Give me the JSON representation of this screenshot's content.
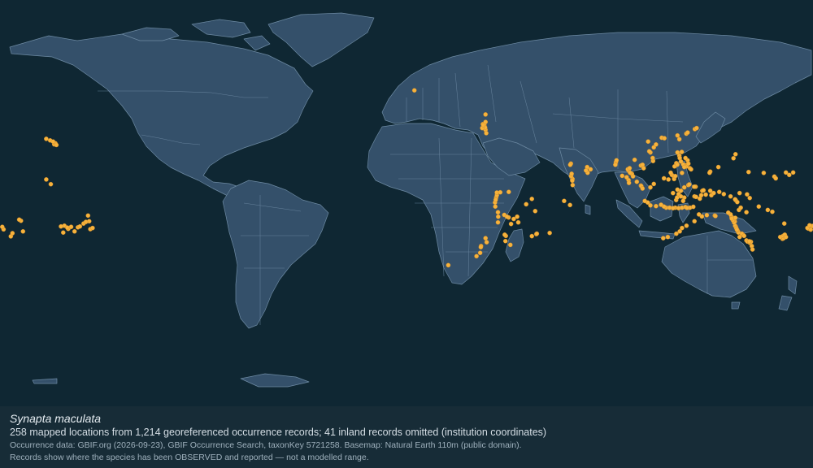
{
  "caption": {
    "species": "Synapta maculata",
    "summary": "258 mapped locations from 1,214 georeferenced occurrence records; 41 inland records omitted (institution coordinates)",
    "source": "Occurrence data: GBIF.org (2026-09-23), GBIF Occurrence Search, taxonKey 5721258. Basemap: Natural Earth 110m (public domain).",
    "note": "Records show where the species has been OBSERVED and reported — not a modelled range."
  },
  "colors": {
    "ocean": "#0f2733",
    "land": "#34506a",
    "border": "#6d8aa3",
    "occurrence": "#f7b23b",
    "caption_bg": "#172c37"
  },
  "occurrences": [
    [
      -156.0,
      19.6
    ],
    [
      -157.8,
      21.3
    ],
    [
      -155.5,
      20.0
    ],
    [
      -159.5,
      22.0
    ],
    [
      -156.5,
      20.8
    ],
    [
      -155.0,
      19.3
    ],
    [
      -149.6,
      -17.6
    ],
    [
      -149.8,
      -17.9
    ],
    [
      -151.5,
      -16.5
    ],
    [
      -150.2,
      -17.3
    ],
    [
      -148.5,
      -17.0
    ],
    [
      -145.5,
      -17.2
    ],
    [
      -144.6,
      -16.8
    ],
    [
      -140.0,
      -18.0
    ],
    [
      -140.5,
      -14.5
    ],
    [
      -141.0,
      -12.0
    ],
    [
      -139.0,
      -17.5
    ],
    [
      -153.0,
      -16.8
    ],
    [
      -143.0,
      -15.5
    ],
    [
      -142.0,
      -14.8
    ],
    [
      -152.0,
      -19.5
    ],
    [
      -147.0,
      -19.0
    ],
    [
      -157.5,
      1.9
    ],
    [
      -159.5,
      4.0
    ],
    [
      -170.7,
      -14.3
    ],
    [
      -171.5,
      -13.8
    ],
    [
      -175.2,
      -21.2
    ],
    [
      -174.5,
      -19.8
    ],
    [
      -169.8,
      -19.0
    ],
    [
      -178.4,
      -18.1
    ],
    [
      -179.0,
      -17.0
    ],
    [
      178.0,
      -17.8
    ],
    [
      179.0,
      -18.2
    ],
    [
      177.5,
      -17.5
    ],
    [
      179.8,
      -16.6
    ],
    [
      178.5,
      -16.3
    ],
    [
      166.5,
      -22.3
    ],
    [
      167.0,
      -22.0
    ],
    [
      165.5,
      -21.5
    ],
    [
      166.8,
      -21.0
    ],
    [
      167.5,
      -20.5
    ],
    [
      168.0,
      -21.5
    ],
    [
      167.3,
      -15.5
    ],
    [
      160.0,
      -9.5
    ],
    [
      162.0,
      -10.3
    ],
    [
      156.0,
      -8.0
    ],
    [
      151.5,
      7.3
    ],
    [
      158.2,
      6.9
    ],
    [
      162.9,
      5.3
    ],
    [
      163.5,
      4.5
    ],
    [
      168.0,
      7.1
    ],
    [
      171.2,
      7.1
    ],
    [
      169.5,
      6.0
    ],
    [
      134.5,
      7.5
    ],
    [
      134.2,
      7.0
    ],
    [
      144.8,
      13.4
    ],
    [
      145.7,
      15.2
    ],
    [
      138.1,
      9.5
    ],
    [
      123.9,
      24.3
    ],
    [
      127.7,
      26.3
    ],
    [
      128.5,
      26.8
    ],
    [
      124.5,
      24.8
    ],
    [
      120.8,
      21.8
    ],
    [
      120.0,
      23.5
    ],
    [
      146.8,
      -19.0
    ],
    [
      147.0,
      -19.5
    ],
    [
      145.8,
      -16.9
    ],
    [
      145.5,
      -16.5
    ],
    [
      146.0,
      -17.5
    ],
    [
      145.4,
      -14.7
    ],
    [
      145.0,
      -15.0
    ],
    [
      144.5,
      -14.0
    ],
    [
      143.9,
      -12.5
    ],
    [
      143.5,
      -11.5
    ],
    [
      142.5,
      -10.7
    ],
    [
      150.5,
      -23.0
    ],
    [
      151.0,
      -23.5
    ],
    [
      152.0,
      -24.0
    ],
    [
      149.0,
      -20.5
    ],
    [
      148.5,
      -20.0
    ],
    [
      152.9,
      -25.5
    ],
    [
      153.2,
      -27.0
    ],
    [
      147.5,
      -21.5
    ],
    [
      146.5,
      -18.5
    ],
    [
      152.5,
      -23.6
    ],
    [
      145.6,
      -13.0
    ],
    [
      144.0,
      -13.3
    ],
    [
      149.5,
      -21.0
    ],
    [
      151.8,
      -23.4
    ],
    [
      146.3,
      -18.2
    ],
    [
      130.8,
      -12.4
    ],
    [
      129.5,
      -11.5
    ],
    [
      133.0,
      -11.8
    ],
    [
      136.5,
      -12.0
    ],
    [
      124.0,
      -16.5
    ],
    [
      122.0,
      -17.5
    ],
    [
      121.0,
      -19.0
    ],
    [
      115.7,
      -21.5
    ],
    [
      119.5,
      -20.0
    ],
    [
      113.7,
      -22.0
    ],
    [
      127.5,
      -14.5
    ],
    [
      136.8,
      -12.2
    ],
    [
      115.0,
      -8.5
    ],
    [
      114.0,
      -8.0
    ],
    [
      116.5,
      -8.5
    ],
    [
      119.0,
      -8.5
    ],
    [
      120.5,
      -8.7
    ],
    [
      122.0,
      -8.5
    ],
    [
      123.5,
      -8.2
    ],
    [
      125.5,
      -8.5
    ],
    [
      127.0,
      -8.1
    ],
    [
      118.0,
      -8.7
    ],
    [
      110.5,
      -7.8
    ],
    [
      106.8,
      -6.2
    ],
    [
      108.0,
      -7.5
    ],
    [
      112.7,
      -7.2
    ],
    [
      105.5,
      -5.5
    ],
    [
      124.2,
      -8.6
    ],
    [
      119.4,
      -5.1
    ],
    [
      119.8,
      -4.0
    ],
    [
      120.5,
      -2.5
    ],
    [
      123.0,
      -4.0
    ],
    [
      122.5,
      -5.5
    ],
    [
      121.5,
      -1.0
    ],
    [
      124.8,
      1.5
    ],
    [
      125.2,
      1.8
    ],
    [
      123.0,
      0.5
    ],
    [
      120.0,
      -0.5
    ],
    [
      121.5,
      -3.5
    ],
    [
      118.0,
      -2.0
    ],
    [
      127.5,
      -3.5
    ],
    [
      128.2,
      -3.7
    ],
    [
      129.9,
      -4.5
    ],
    [
      130.5,
      -3.0
    ],
    [
      131.0,
      -1.0
    ],
    [
      131.5,
      -0.8
    ],
    [
      134.5,
      -1.0
    ],
    [
      135.0,
      -3.0
    ],
    [
      136.0,
      -2.0
    ],
    [
      138.5,
      -1.5
    ],
    [
      140.5,
      -2.5
    ],
    [
      128.0,
      0.8
    ],
    [
      127.4,
      0.8
    ],
    [
      132.5,
      -2.7
    ],
    [
      143.5,
      -3.5
    ],
    [
      145.8,
      -5.2
    ],
    [
      146.5,
      -6.0
    ],
    [
      147.2,
      -9.5
    ],
    [
      150.5,
      -10.5
    ],
    [
      152.0,
      -4.2
    ],
    [
      150.8,
      -2.6
    ],
    [
      145.5,
      -4.8
    ],
    [
      147.5,
      -2.0
    ],
    [
      148.0,
      -8.5
    ],
    [
      120.8,
      14.5
    ],
    [
      121.0,
      13.5
    ],
    [
      123.8,
      10.3
    ],
    [
      124.0,
      9.8
    ],
    [
      122.5,
      10.7
    ],
    [
      118.7,
      9.8
    ],
    [
      119.5,
      11.2
    ],
    [
      124.5,
      12.5
    ],
    [
      125.5,
      9.0
    ],
    [
      122.0,
      6.9
    ],
    [
      121.5,
      12.0
    ],
    [
      120.0,
      16.0
    ],
    [
      123.5,
      13.5
    ],
    [
      119.9,
      10.6
    ],
    [
      126.0,
      8.5
    ],
    [
      121.9,
      16.2
    ],
    [
      123.0,
      9.5
    ],
    [
      124.8,
      11.0
    ],
    [
      117.5,
      6.0
    ],
    [
      118.5,
      5.0
    ],
    [
      116.0,
      4.0
    ],
    [
      114.0,
      4.5
    ],
    [
      118.5,
      4.2
    ],
    [
      119.0,
      5.5
    ],
    [
      117.0,
      7.0
    ],
    [
      109.5,
      2.0
    ],
    [
      108.0,
      0.5
    ],
    [
      103.8,
      1.3
    ],
    [
      104.0,
      1.0
    ],
    [
      100.3,
      5.4
    ],
    [
      99.8,
      6.5
    ],
    [
      98.4,
      7.9
    ],
    [
      98.0,
      8.5
    ],
    [
      99.0,
      7.0
    ],
    [
      98.8,
      9.0
    ],
    [
      101.0,
      12.7
    ],
    [
      103.8,
      10.2
    ],
    [
      104.5,
      10.5
    ],
    [
      105.0,
      9.0
    ],
    [
      102.0,
      3.0
    ],
    [
      98.3,
      3.7
    ],
    [
      97.5,
      5.0
    ],
    [
      95.5,
      5.6
    ],
    [
      104.5,
      0.0
    ],
    [
      98.5,
      2.5
    ],
    [
      108.0,
      16.0
    ],
    [
      109.2,
      12.2
    ],
    [
      109.0,
      13.5
    ],
    [
      107.0,
      20.8
    ],
    [
      109.5,
      18.2
    ],
    [
      110.5,
      19.5
    ],
    [
      113.0,
      22.5
    ],
    [
      114.2,
      22.3
    ],
    [
      107.5,
      16.5
    ],
    [
      92.7,
      11.6
    ],
    [
      93.0,
      12.5
    ],
    [
      92.5,
      10.5
    ],
    [
      80.0,
      9.5
    ],
    [
      80.2,
      7.0
    ],
    [
      81.5,
      8.5
    ],
    [
      79.5,
      8.0
    ],
    [
      72.8,
      11.0
    ],
    [
      72.5,
      10.5
    ],
    [
      73.5,
      4.2
    ],
    [
      73.4,
      3.5
    ],
    [
      72.9,
      5.5
    ],
    [
      73.1,
      6.5
    ],
    [
      73.6,
      1.5
    ],
    [
      72.4,
      -7.3
    ],
    [
      69.8,
      -5.5
    ],
    [
      57.5,
      -20.2
    ],
    [
      57.7,
      -20.0
    ],
    [
      55.5,
      -21.1
    ],
    [
      63.4,
      -19.7
    ],
    [
      55.5,
      -4.6
    ],
    [
      53.0,
      -7.0
    ],
    [
      57.0,
      -10.0
    ],
    [
      46.3,
      -15.7
    ],
    [
      47.5,
      -13.5
    ],
    [
      49.0,
      -12.5
    ],
    [
      49.5,
      -15.0
    ],
    [
      43.8,
      -23.3
    ],
    [
      45.2,
      -12.8
    ],
    [
      43.3,
      -11.7
    ],
    [
      44.5,
      -12.5
    ],
    [
      44.0,
      -21.0
    ],
    [
      46.0,
      -25.0
    ],
    [
      43.5,
      -20.5
    ],
    [
      39.7,
      -4.0
    ],
    [
      39.2,
      -6.2
    ],
    [
      39.5,
      -5.0
    ],
    [
      40.0,
      -3.0
    ],
    [
      39.3,
      -8.0
    ],
    [
      40.5,
      -10.5
    ],
    [
      40.6,
      -12.5
    ],
    [
      40.5,
      -15.0
    ],
    [
      35.5,
      -23.8
    ],
    [
      35.0,
      -22.0
    ],
    [
      33.0,
      -25.5
    ],
    [
      32.9,
      -26.0
    ],
    [
      32.6,
      -28.5
    ],
    [
      31.0,
      -30.0
    ],
    [
      18.5,
      -34.0
    ],
    [
      45.3,
      -1.5
    ],
    [
      40.0,
      -1.8
    ],
    [
      41.5,
      -1.7
    ],
    [
      34.5,
      28.0
    ],
    [
      34.0,
      27.5
    ],
    [
      35.0,
      26.0
    ],
    [
      34.8,
      27.0
    ],
    [
      33.8,
      28.5
    ],
    [
      35.0,
      29.5
    ],
    [
      33.5,
      26.8
    ],
    [
      35.3,
      24.5
    ],
    [
      34.0,
      28.2
    ],
    [
      35.0,
      32.8
    ],
    [
      3.5,
      43.5
    ]
  ]
}
